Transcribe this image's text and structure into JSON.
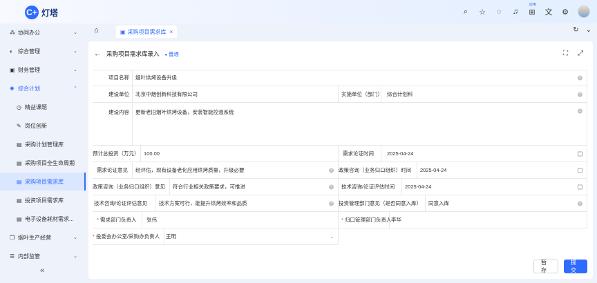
{
  "app": {
    "logo_glyph": "C+",
    "name": "灯塔",
    "accent": "#2f6bff"
  },
  "top_icons": [
    "search-icon",
    "star-icon",
    "chat-icon",
    "bell-icon",
    "apps-icon",
    "translate-icon",
    "settings-icon"
  ],
  "top_badge": "应用",
  "sidebar": {
    "items": [
      {
        "label": "协同办公",
        "icon": "share-icon",
        "arrow": "⌄"
      },
      {
        "label": "综合管理",
        "icon": "half-circle-icon",
        "arrow": "⌄"
      },
      {
        "label": "财务管理",
        "icon": "wallet-icon",
        "arrow": "⌄"
      },
      {
        "label": "综合计划",
        "icon": "sun-icon",
        "arrow": "⌃"
      },
      {
        "label": "精益课题",
        "icon": "clock-icon"
      },
      {
        "label": "岗位创新",
        "icon": "pen-icon"
      },
      {
        "label": "采购计划管理库",
        "icon": "doc-icon"
      },
      {
        "label": "采购项目全生命周期",
        "icon": "doc-icon"
      },
      {
        "label": "采购项目需求库",
        "icon": "doc-icon"
      },
      {
        "label": "投资项目需求库",
        "icon": "doc-icon"
      },
      {
        "label": "电子设备耗材需求...",
        "icon": "doc-icon"
      },
      {
        "label": "烟叶生产经营",
        "icon": "copy-icon",
        "arrow": "⌄"
      },
      {
        "label": "内部监管",
        "icon": "list-icon",
        "arrow": "⌄"
      }
    ],
    "collapse": "«"
  },
  "tabs": {
    "home": "⌂",
    "active_tab": "采购项目需求库",
    "close": "×"
  },
  "page": {
    "title": "采购项目需求库录入",
    "status": "普通",
    "back": "←"
  },
  "form": {
    "project_name": {
      "label": "项目名称",
      "value": "烟叶烘烤设备升级"
    },
    "build_unit": {
      "label": "建设单位",
      "value": "北京中烟创新科技有限公司"
    },
    "impl_unit": {
      "label": "实施单位（部门）",
      "value": "综合计划科"
    },
    "content": {
      "label": "建设内容",
      "value": "更新老旧烟叶烘烤设备，安装智能控温系统"
    },
    "invest": {
      "label": "预计总投资（万元）",
      "value": "100.00"
    },
    "demand_date": {
      "label": "需求论证时间",
      "value": "2025-04-24"
    },
    "demand_opinion": {
      "label": "需求论证意见",
      "value": "经评估，现有设备老化应用烘烤质量，升级必要"
    },
    "policy_time": {
      "label": "政策咨询（业务归口组织）时间",
      "value": "2025-04-24"
    },
    "policy_opinion": {
      "label": "政策咨询（业务归口组织）意见",
      "value": "符合行业相关政策要求，可推进"
    },
    "tech_time": {
      "label": "技术咨询/论证评估时间",
      "value": "2025-04-24"
    },
    "tech_opinion": {
      "label": "技术咨询/论证评估意见",
      "value": "技术方案可行，能提升烘烤效率和品质"
    },
    "invest_dept": {
      "label": "投资管理部门意见（是否同意入库）",
      "value": "同意入库"
    },
    "demand_head": {
      "label": "需求部门负责人",
      "value": "张伟"
    },
    "central_head": {
      "label": "归口管理部门负责人",
      "value": "李华"
    },
    "committee": {
      "label": "投委会办公室/采购办负责人",
      "value": "王明"
    }
  },
  "buttons": {
    "save": "暂存",
    "submit": "提交"
  }
}
